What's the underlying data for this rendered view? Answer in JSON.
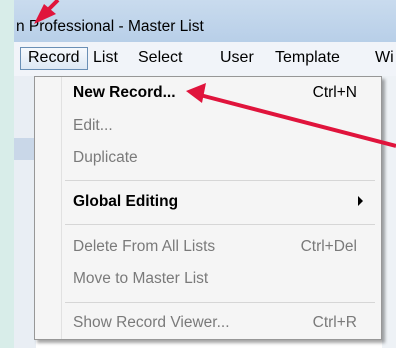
{
  "window": {
    "title": "n Professional - Master List"
  },
  "menubar": {
    "items": [
      {
        "label": "Record"
      },
      {
        "label": "List"
      },
      {
        "label": "Select"
      },
      {
        "label": "User"
      },
      {
        "label": "Template"
      },
      {
        "label": "Wi"
      }
    ]
  },
  "dropdown": {
    "items": [
      {
        "label": "New Record...",
        "shortcut": "Ctrl+N",
        "state": "enabled"
      },
      {
        "label": "Edit...",
        "shortcut": "",
        "state": "disabled"
      },
      {
        "label": "Duplicate",
        "shortcut": "",
        "state": "disabled"
      },
      {
        "label": "Global Editing",
        "shortcut": "",
        "state": "enabled",
        "submenu": true
      },
      {
        "label": "Delete From All Lists",
        "shortcut": "Ctrl+Del",
        "state": "disabled"
      },
      {
        "label": "Move to Master List",
        "shortcut": "",
        "state": "disabled"
      },
      {
        "label": "Show Record Viewer...",
        "shortcut": "Ctrl+R",
        "state": "disabled"
      }
    ]
  },
  "colors": {
    "annotation_arrow": "#e0143c",
    "background": "#d8ede9"
  }
}
